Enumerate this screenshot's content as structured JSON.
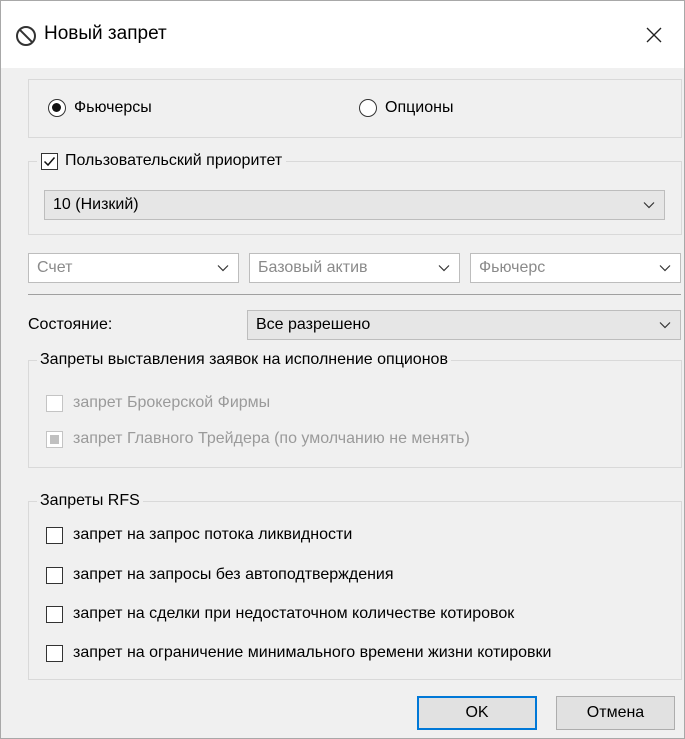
{
  "window": {
    "title": "Новый запрет",
    "icon": "prohibited-icon",
    "close_icon": "close-icon"
  },
  "instrument": {
    "options": [
      {
        "label": "Фьючерсы",
        "selected": true
      },
      {
        "label": "Опционы",
        "selected": false
      }
    ]
  },
  "priority": {
    "checkbox_label": "Пользовательский приоритет",
    "checked": true,
    "selected_value": "10 (Низкий)"
  },
  "filters": {
    "account_placeholder": "Счет",
    "base_asset_placeholder": "Базовый актив",
    "future_placeholder": "Фьючерс"
  },
  "state": {
    "label": "Состояние:",
    "value": "Все разрешено"
  },
  "exercise_bans": {
    "title": "Запреты  выставления заявок на исполнение опционов",
    "items": [
      {
        "label": "запрет Брокерской Фирмы",
        "state": "unchecked",
        "enabled": false
      },
      {
        "label": "запрет Главного Трейдера (по умолчанию не менять)",
        "state": "indeterminate",
        "enabled": false
      }
    ]
  },
  "rfs_bans": {
    "title": "Запреты RFS",
    "items": [
      {
        "label": "запрет на запрос потока ликвидности",
        "checked": false
      },
      {
        "label": "запрет на запросы без автоподтверждения",
        "checked": false
      },
      {
        "label": "запрет на сделки при недостаточном количестве котировок",
        "checked": false
      },
      {
        "label": "запрет на ограничение минимального времени жизни котировки",
        "checked": false
      }
    ]
  },
  "buttons": {
    "ok": "OK",
    "cancel": "Отмена"
  }
}
